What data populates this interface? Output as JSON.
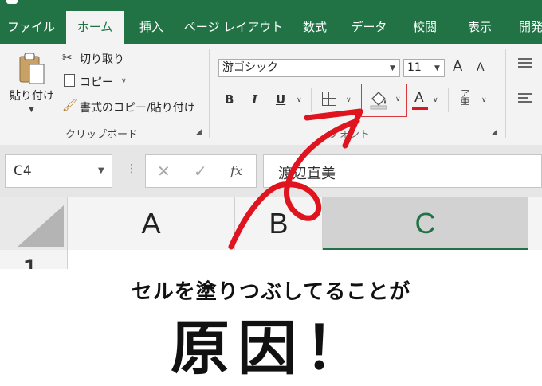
{
  "tabs": [
    "ファイル",
    "ホーム",
    "挿入",
    "ページ レイアウト",
    "数式",
    "データ",
    "校閲",
    "表示",
    "開発"
  ],
  "ribbon": {
    "paste_label": "貼り付け",
    "cut_label": "切り取り",
    "copy_label": "コピー",
    "format_painter_label": "書式のコピー/貼り付け",
    "clipboard_group": "クリップボード",
    "font_name": "游ゴシック",
    "font_size": "11",
    "font_group": "フォント",
    "bold": "B",
    "italic": "I",
    "underline": "U",
    "font_color_glyph": "A",
    "grow_glyph": "A",
    "shrink_glyph": "A"
  },
  "formula_bar": {
    "name_box": "C4",
    "fx": "fx",
    "value": "渡辺直美"
  },
  "grid": {
    "columns": [
      "A",
      "B",
      "C"
    ],
    "row_1": "1"
  },
  "overlay": {
    "caption": "セルを塗りつぶしてることが",
    "headline": "原因！"
  },
  "colors": {
    "excel_green": "#217346",
    "annotation_red": "#e0141e",
    "highlight_border": "#d9373a"
  }
}
